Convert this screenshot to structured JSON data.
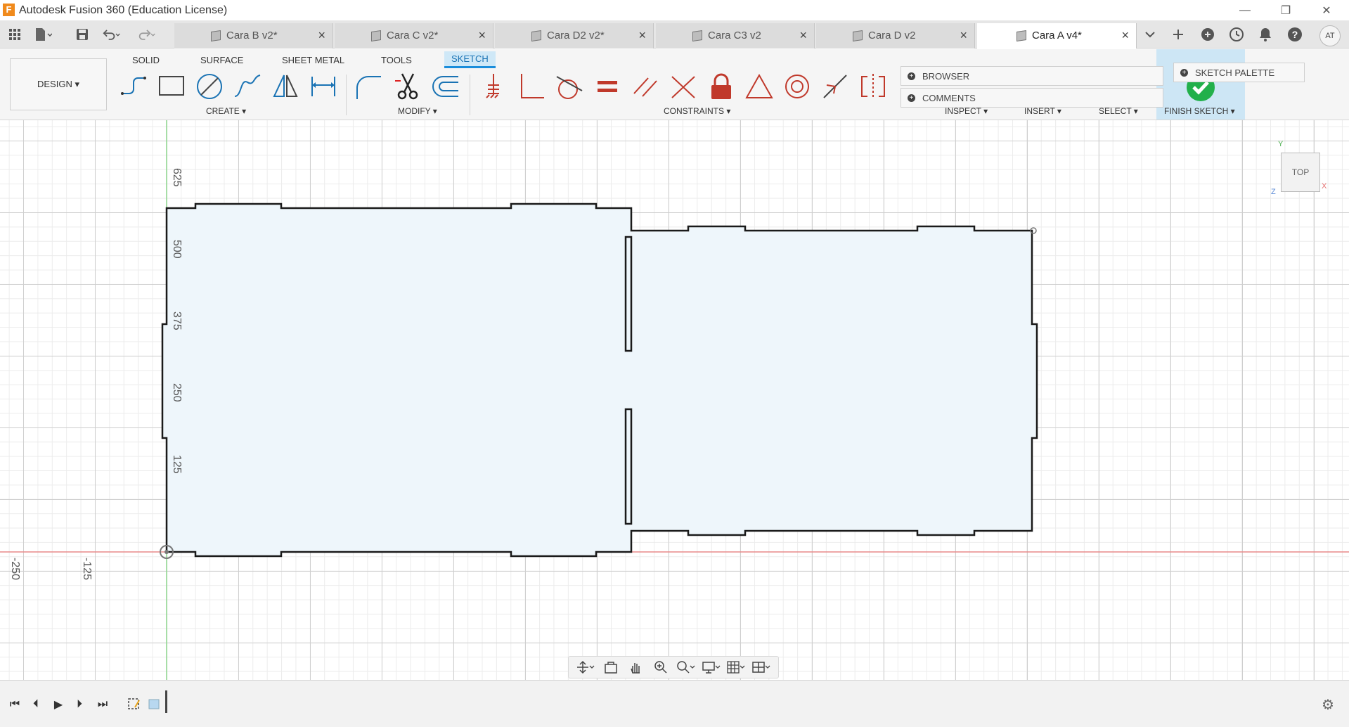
{
  "window": {
    "title": "Autodesk Fusion 360 (Education License)",
    "logo_letter": "F",
    "minimize": "—",
    "restore": "❐",
    "close": "✕"
  },
  "tabs": [
    {
      "label": "Cara B v2*",
      "active": false
    },
    {
      "label": "Cara C v2*",
      "active": false
    },
    {
      "label": "Cara D2 v2*",
      "active": false
    },
    {
      "label": "Cara C3 v2",
      "active": false
    },
    {
      "label": "Cara D v2",
      "active": false
    },
    {
      "label": "Cara A v4*",
      "active": true
    }
  ],
  "tab_close": "×",
  "user": {
    "initials": "AT"
  },
  "toolbar": {
    "design_label": "DESIGN ▾",
    "workspace_tabs": [
      "SOLID",
      "SURFACE",
      "SHEET METAL",
      "TOOLS",
      "SKETCH"
    ],
    "active_workspace": "SKETCH",
    "groups": {
      "create": "CREATE ▾",
      "modify": "MODIFY ▾",
      "constraints": "CONSTRAINTS ▾",
      "inspect": "INSPECT ▾",
      "insert": "INSERT ▾",
      "select": "SELECT ▾",
      "finish": "FINISH SKETCH ▾"
    }
  },
  "panels": {
    "browser": "BROWSER",
    "comments": "COMMENTS",
    "sketch_palette": "SKETCH PALETTE"
  },
  "canvas": {
    "y_axis_labels": [
      "625",
      "500",
      "375",
      "250",
      "125"
    ],
    "x_axis_labels": [
      "-250",
      "-125"
    ],
    "viewcube_label": "TOP",
    "axis_y_letter": "Y",
    "axis_x_letter": "X",
    "axis_z_letter": "Z",
    "colors": {
      "sketch_fill": "#eef6fb",
      "sketch_stroke": "#1a1a1a",
      "x_axis": "#e88a8a",
      "y_axis": "#8fd88f"
    }
  },
  "timeline": {
    "first": "⏮",
    "prev": "⏴",
    "play": "▶",
    "next": "⏵",
    "last": "⏭",
    "settings": "⚙"
  }
}
